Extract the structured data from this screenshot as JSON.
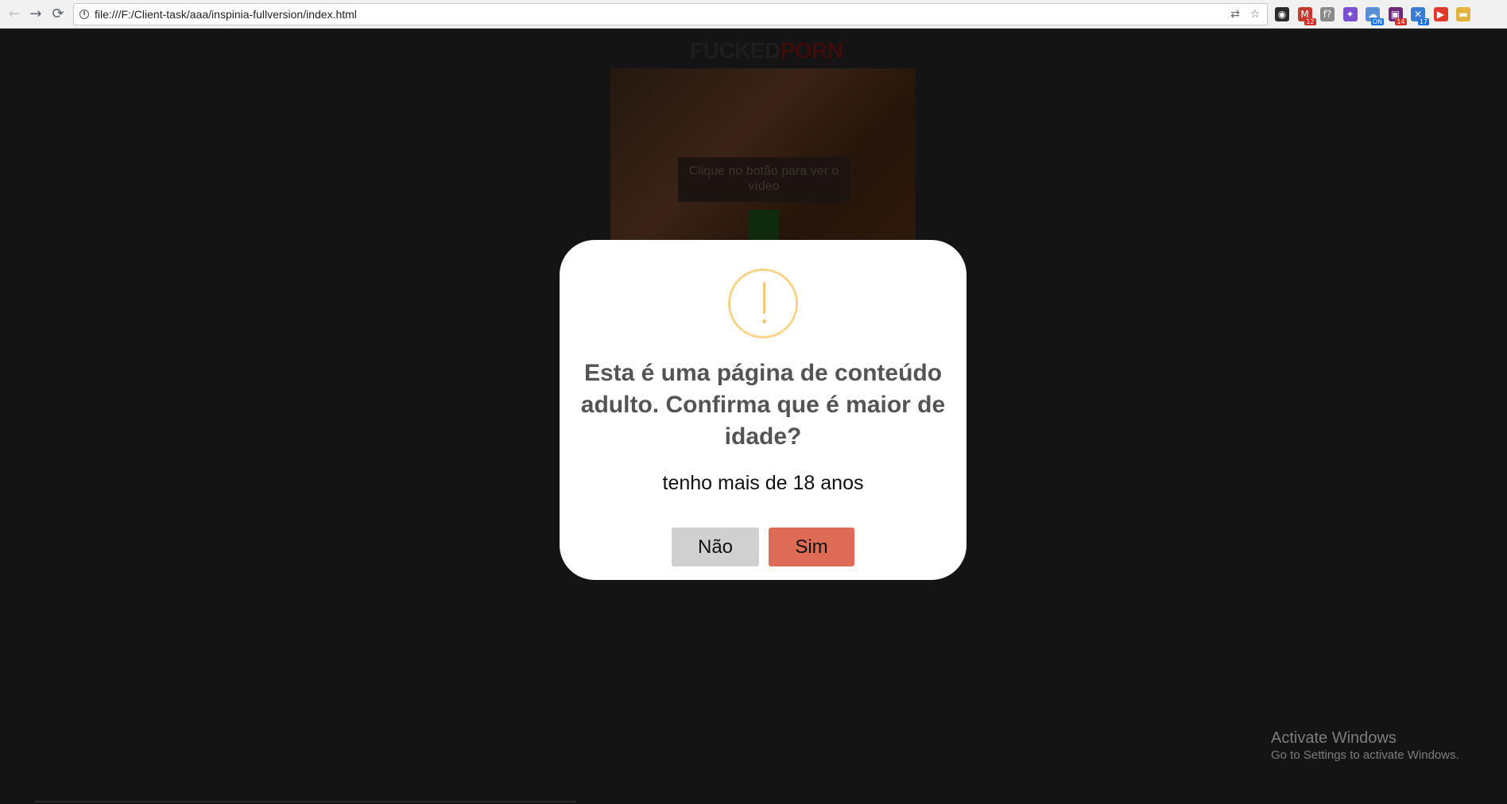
{
  "browser": {
    "back_glyph": "←",
    "forward_glyph": "→",
    "reload_glyph": "⟳",
    "info_glyph": "i",
    "url": "file:///F:/Client-task/aaa/inspinia-fullversion/index.html",
    "translate_glyph": "⇄",
    "star_glyph": "☆",
    "extensions": [
      {
        "name": "circle-extension",
        "glyph": "◉",
        "color": "#2b2b2b",
        "badge": ""
      },
      {
        "name": "mail-extension",
        "glyph": "M",
        "color": "#c33b2f",
        "badge": "12",
        "badge_color": "#d93025"
      },
      {
        "name": "formula-extension",
        "glyph": "f?",
        "color": "#8a8a8a",
        "badge": ""
      },
      {
        "name": "color-extension",
        "glyph": "✦",
        "color": "#7a4fd1",
        "badge": ""
      },
      {
        "name": "on-extension",
        "glyph": "☁",
        "color": "#5a8fd6",
        "badge": "ON",
        "badge_color": "#1a73e8"
      },
      {
        "name": "purple-extension",
        "glyph": "▣",
        "color": "#6b2a7a",
        "badge": "14",
        "badge_color": "#d93025"
      },
      {
        "name": "x-extension",
        "glyph": "✕",
        "color": "#3a7bd5",
        "badge": "17",
        "badge_color": "#1a73e8"
      },
      {
        "name": "play-extension",
        "glyph": "▶",
        "color": "#e03a2f",
        "badge": ""
      },
      {
        "name": "folder-extension",
        "glyph": "▬",
        "color": "#e0b33a",
        "badge": ""
      }
    ]
  },
  "background_page": {
    "logo_part1": "FUCKED",
    "logo_part2": "PORN",
    "video_message": "Clique no botão para ver o vídeo"
  },
  "modal": {
    "icon": "warning-icon",
    "title": "Esta é uma página de conteúdo adulto. Confirma que é maior de idade?",
    "text": "tenho mais de 18 anos",
    "no_label": "Não",
    "yes_label": "Sim",
    "icon_color": "#f8d48c",
    "yes_color": "#dd6b55",
    "no_color": "#d0d0d0"
  },
  "watermark": {
    "title": "Activate Windows",
    "subtitle": "Go to Settings to activate Windows."
  }
}
